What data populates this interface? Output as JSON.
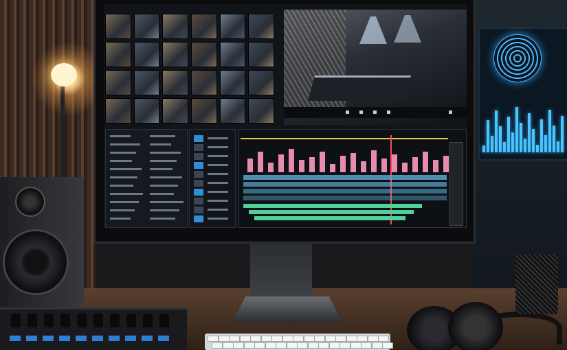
{
  "scene": {
    "description_visible_text": {
      "viewer_label": "",
      "ruler_labels": [
        "",
        "",
        "",
        "",
        ""
      ]
    }
  },
  "colors": {
    "accent_blue": "#2c8fd8",
    "clip_pink": "#e68cb0",
    "clip_blue": "#5fb0d8",
    "clip_green": "#4fd29a",
    "ruler_yellow": "#e5c844",
    "playhead_red": "#ff4c4c"
  },
  "icons": [
    "speaker-icon",
    "headphones-icon",
    "lamp-icon",
    "spiral-visualizer-icon"
  ]
}
